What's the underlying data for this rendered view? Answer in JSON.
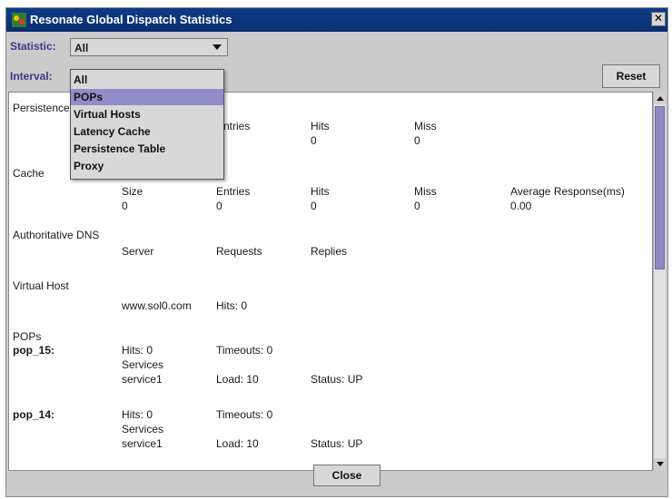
{
  "window": {
    "title": "Resonate Global Dispatch Statistics",
    "close_glyph": "✕"
  },
  "toolbar": {
    "statistic_label": "Statistic:",
    "statistic_value": "All",
    "interval_label": "Interval:",
    "reset_label": "Reset"
  },
  "dropdown": {
    "options": [
      "All",
      "POPs",
      "Virtual Hosts",
      "Latency Cache",
      "Persistence Table",
      "Proxy"
    ],
    "highlighted": "POPs"
  },
  "persistence": {
    "label": "Persistence",
    "headers": [
      "Entries",
      "Hits",
      "Miss"
    ],
    "values": [
      "0",
      "0"
    ]
  },
  "cache": {
    "label": "Cache",
    "headers": [
      "Size",
      "Entries",
      "Hits",
      "Miss",
      "Average Response(ms)"
    ],
    "values": [
      "0",
      "0",
      "0",
      "0",
      "0.00"
    ]
  },
  "dns": {
    "label": "Authoritative DNS",
    "headers": [
      "Server",
      "Requests",
      "Replies"
    ]
  },
  "virtual_host": {
    "label": "Virtual Host",
    "host": "www.sol0.com",
    "hits": "Hits: 0"
  },
  "pops": {
    "label": "POPs",
    "items": [
      {
        "name": "pop_15:",
        "hits": "Hits: 0",
        "timeouts": "Timeouts: 0",
        "services_label": "Services",
        "service": "service1",
        "load": "Load: 10",
        "status": "Status: UP"
      },
      {
        "name": "pop_14:",
        "hits": "Hits: 0",
        "timeouts": "Timeouts: 0",
        "services_label": "Services",
        "service": "service1",
        "load": "Load: 10",
        "status": "Status: UP"
      }
    ]
  },
  "footer": {
    "close_label": "Close"
  },
  "colors": {
    "titlebar": "#0d3b86",
    "selection": "#8e8ec8",
    "label": "#3a3a8a"
  },
  "icons": [
    "app-icon",
    "close-icon",
    "chevron-down-icon",
    "scroll-up-icon",
    "scroll-down-icon"
  ]
}
